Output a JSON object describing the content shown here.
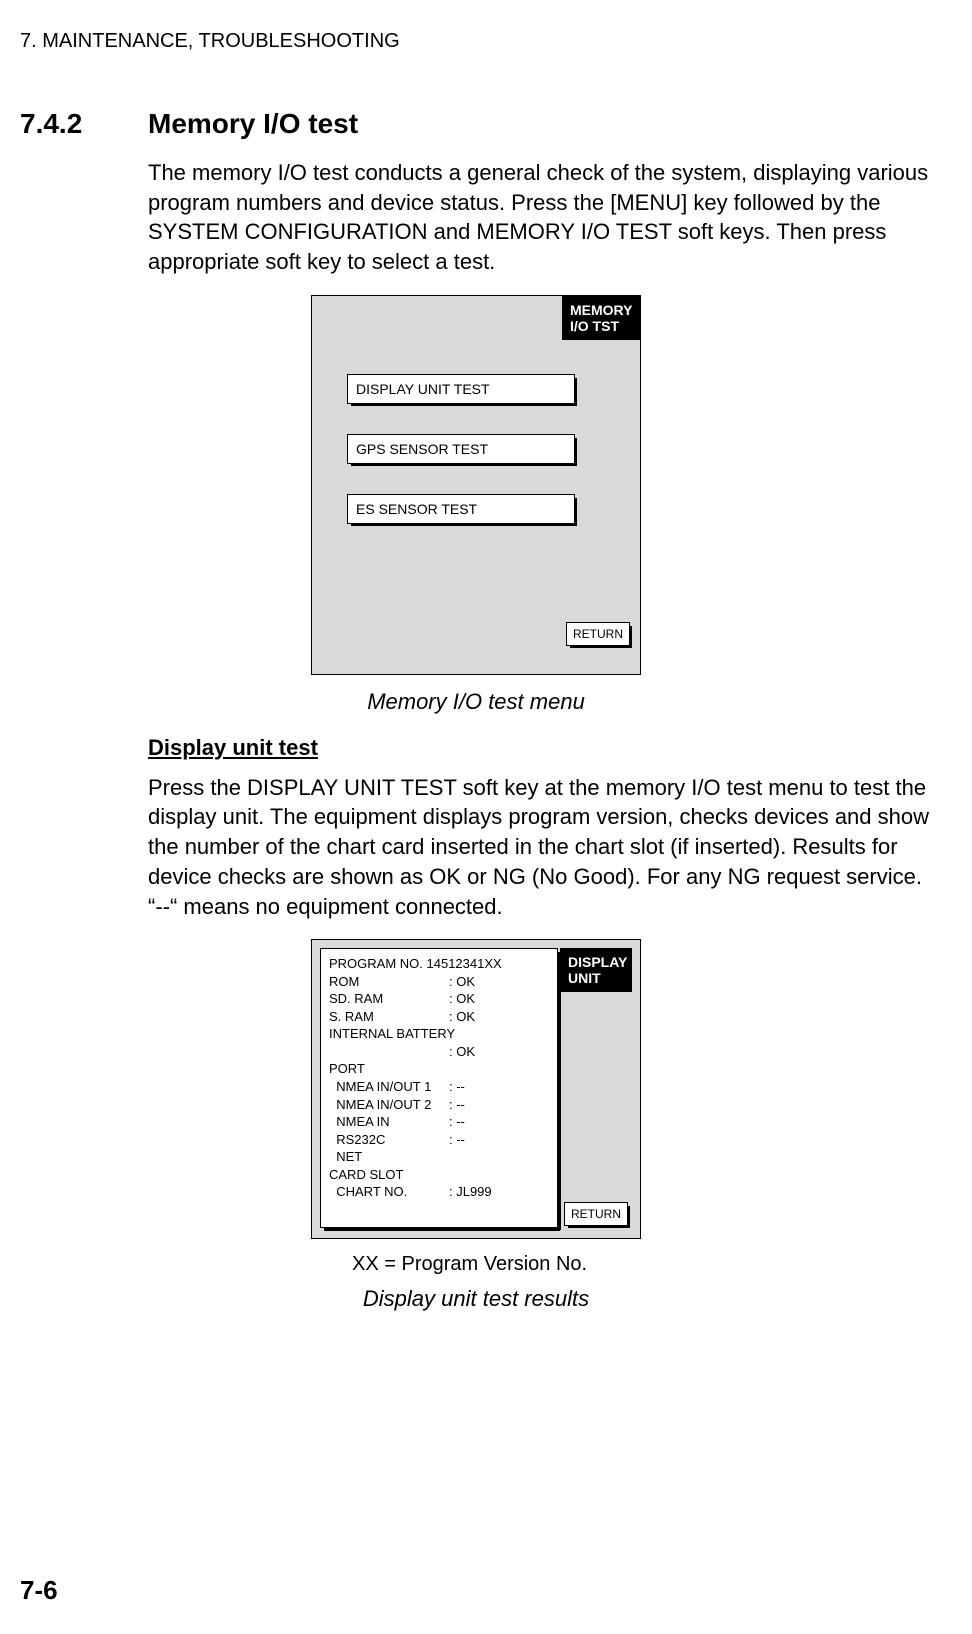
{
  "chapter_header": "7. MAINTENANCE, TROUBLESHOOTING",
  "section": {
    "number": "7.4.2",
    "title": "Memory I/O test"
  },
  "intro_paragraph": "The memory I/O test conducts a general check of the system, displaying various program numbers and device status. Press the [MENU] key followed by the SYSTEM CONFIGURATION and MEMORY I/O TEST soft keys. Then press appropriate soft key to select a test.",
  "fig1": {
    "softkey_line1": "MEMORY",
    "softkey_line2": "I/O TST",
    "buttons": {
      "b1": "DISPLAY UNIT TEST",
      "b2": "GPS SENSOR TEST",
      "b3": "ES SENSOR TEST"
    },
    "return": "RETURN",
    "caption": "Memory I/O test menu"
  },
  "sub_heading": "Display unit test",
  "paragraph2": "Press the DISPLAY UNIT TEST soft key at the memory I/O test menu to test the display unit. The equipment displays program version, checks devices and show the number of the chart card inserted in the chart slot (if inserted). Results for device checks are shown as OK or NG (No Good). For any NG request service. “--“ means no equipment connected.",
  "fig2": {
    "softkey_line1": "DISPLAY",
    "softkey_line2": "UNIT",
    "rows": {
      "prog": {
        "label": "PROGRAM NO. 14512341XX",
        "value": ""
      },
      "rom": {
        "label": "ROM",
        "value": ": OK"
      },
      "sdram": {
        "label": "SD. RAM",
        "value": ": OK"
      },
      "sram": {
        "label": "S. RAM",
        "value": ": OK"
      },
      "intbat": {
        "label": "INTERNAL BATTERY",
        "value": ""
      },
      "intbat_val": {
        "label": "",
        "value": ": OK"
      },
      "port": {
        "label": "PORT",
        "value": ""
      },
      "nmea1": {
        "label": "  NMEA IN/OUT 1",
        "value": ": --"
      },
      "nmea2": {
        "label": "  NMEA IN/OUT 2",
        "value": ": --"
      },
      "nmeain": {
        "label": "  NMEA IN",
        "value": ": --"
      },
      "rs232c": {
        "label": "  RS232C",
        "value": ": --"
      },
      "net": {
        "label": "  NET",
        "value": ""
      },
      "cardslot": {
        "label": "CARD SLOT",
        "value": ""
      },
      "chartno": {
        "label": "  CHART NO.",
        "value": ": JL999"
      }
    },
    "return": "RETURN",
    "note": "XX = Program Version No.",
    "caption": "Display unit test results"
  },
  "page_number": "7-6"
}
